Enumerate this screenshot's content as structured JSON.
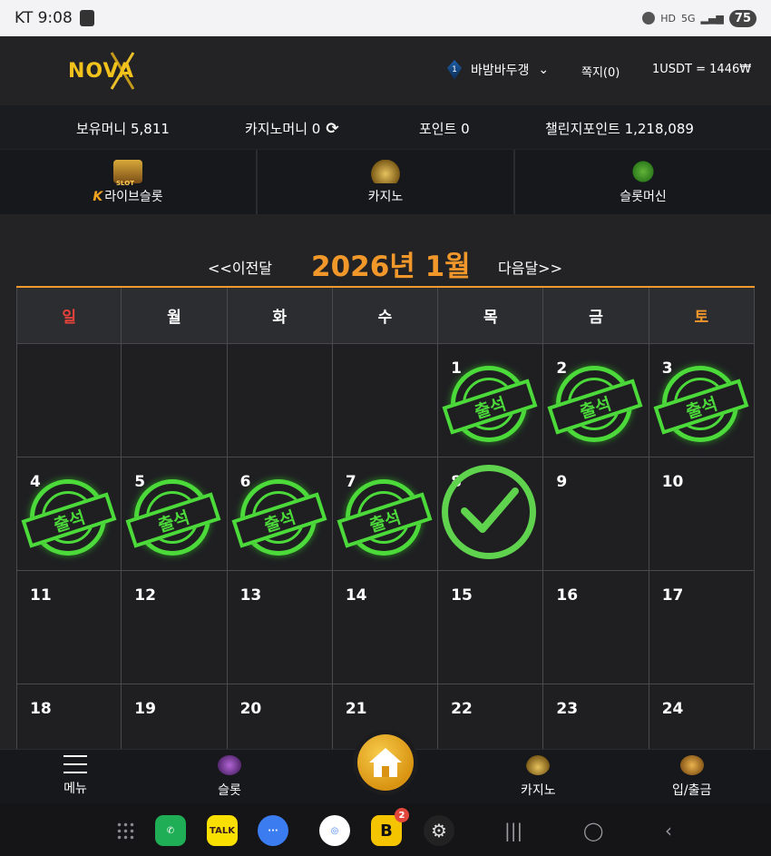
{
  "status_bar": {
    "carrier_time": "KT 9:08",
    "battery": "75",
    "icons": [
      "mute-icon",
      "hd-icon",
      "5g-icon",
      "signal-icon"
    ]
  },
  "header": {
    "logo": "NOVA",
    "username": "바밤바두갱",
    "level": "1",
    "messages": "쪽지(0)",
    "rate": "1USDT = 1446₩"
  },
  "money": {
    "holding": "보유머니 5,811",
    "casino": "카지노머니 0",
    "points": "포인트 0",
    "challenge": "챌린지포인트 1,218,089"
  },
  "categories": [
    {
      "label": "라이브슬롯",
      "icon": "slot-icon"
    },
    {
      "label": "카지노",
      "icon": "casino-icon"
    },
    {
      "label": "슬롯머신",
      "icon": "slot-machine-icon"
    }
  ],
  "calendar": {
    "prev": "<<이전달",
    "next": "다음달>>",
    "title": "2026년 1월",
    "weekdays": [
      "일",
      "월",
      "화",
      "수",
      "목",
      "금",
      "토"
    ],
    "stamp_text": "출석",
    "colors": {
      "sunday": "#e4423a",
      "saturday": "#f2982b",
      "accent": "#f2982b",
      "stamp": "#4cd93a"
    }
  },
  "bottom_nav": {
    "menu": "메뉴",
    "slot": "슬롯",
    "casino": "카지노",
    "deposit": "입/출금"
  },
  "dock": {
    "kakao": "TALK",
    "b_badge": "2"
  }
}
